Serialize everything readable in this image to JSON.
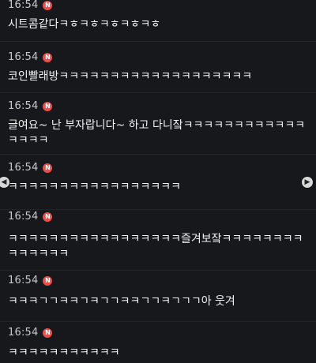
{
  "messages": [
    {
      "time": "16:54",
      "badge": "N",
      "text": "시트콤같다ㅋㅎㅋㅎㅋㅎㅋㅎㅋㅎ"
    },
    {
      "time": "16:54",
      "badge": "N",
      "text": "코인빨래방ㅋㅋㅋㅋㅋㅋㅋㅋㅋㅋㅋㅋㅋㅋㅋㅋㅋㅋㅋ"
    },
    {
      "time": "16:54",
      "badge": "N",
      "text": "글여요~ 난 부자랍니다~ 하고 다니잨ㅋㅋㅋㅋㅋㅋㅋㅋㅋㅋㅋㅋㅋㅋㅋㅋ"
    },
    {
      "time": "16:54",
      "badge": "N",
      "text": "ㅋㅋㅋㅋㅋㅋㅋㅋㅋㅋㅋㅋㅋㅋㅋㅋㅋ"
    },
    {
      "time": "16:54",
      "badge": "N",
      "text": "ㅋㅋㅋㅋㅋㅋㅋㅋㅋㅋㅋㅋㅋㅋㅋㅋㅋ즐겨보잨ㅋㅋㅋㅋㅋㅋㅋㅋㅋㅋㅋㅋㅋㅋ"
    },
    {
      "time": "16:54",
      "badge": "N",
      "text": "ㅋㅋㅋㄱㄱㅋㅋㄱㅋㄱㄱㅋㅋㄱㄱㅋㄱㄱㄱ아 웃겨"
    },
    {
      "time": "16:54",
      "badge": "N",
      "text": "ㅋㅋㅋㅋㅋㅋㅋㅋㅋㅋㅋ"
    }
  ],
  "nav": {
    "prev_icon": "chevron-left-icon",
    "next_icon": "chevron-right-icon"
  },
  "colors": {
    "background": "#17181b",
    "badge": "#ef4d45",
    "text": "#f1f1f1",
    "time": "#c9c9c9"
  }
}
